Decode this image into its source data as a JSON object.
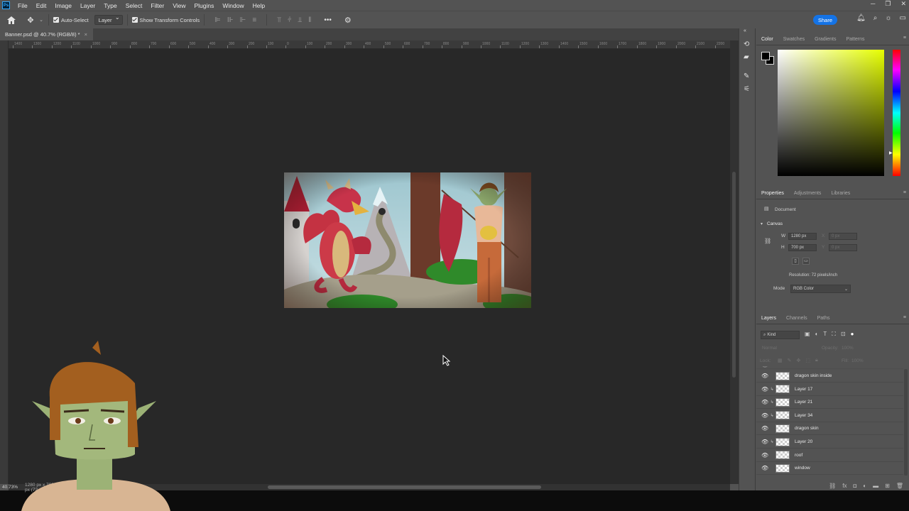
{
  "menu": [
    "File",
    "Edit",
    "Image",
    "Layer",
    "Type",
    "Select",
    "Filter",
    "View",
    "Plugins",
    "Window",
    "Help"
  ],
  "options": {
    "auto_select_label": "Auto-Select",
    "auto_select_target": "Layer",
    "transform_label": "Show Transform Controls",
    "more": "•••",
    "share": "Share"
  },
  "document": {
    "tab_title": "Banner.psd @ 40.7% (RGB/8) *",
    "close": "×"
  },
  "ruler_labels": [
    "1400",
    "1300",
    "1200",
    "1100",
    "1000",
    "900",
    "800",
    "700",
    "600",
    "500",
    "400",
    "300",
    "200",
    "100",
    "0",
    "100",
    "200",
    "300",
    "400",
    "500",
    "600",
    "700",
    "800",
    "900",
    "1000",
    "1100",
    "1200",
    "1300",
    "1400",
    "1500",
    "1600",
    "1700",
    "1800",
    "1900",
    "2000",
    "2100",
    "2200"
  ],
  "status": {
    "zoom": "40.73%",
    "size": "1280 px x 700 px (72 ppi)"
  },
  "color_panel": {
    "tabs": [
      "Color",
      "Swatches",
      "Gradients",
      "Patterns"
    ],
    "active": 0,
    "hue_color": "#e6ff00"
  },
  "properties_panel": {
    "tabs": [
      "Properties",
      "Adjustments",
      "Libraries"
    ],
    "doc_label": "Document",
    "canvas_label": "Canvas",
    "w_label": "W",
    "w_value": "1280 px",
    "h_label": "H",
    "h_value": "700 px",
    "x_label": "X",
    "x_value": "0 px",
    "y_label": "Y",
    "y_value": "0 px",
    "resolution": "Resolution: 72 pixels/inch",
    "mode_label": "Mode",
    "mode_value": "RGB Color"
  },
  "layers_panel": {
    "tabs": [
      "Layers",
      "Channels",
      "Paths"
    ],
    "kind_filter": "Kind",
    "blend_mode": "Normal",
    "opacity_label": "Opacity:",
    "opacity_value": "100%",
    "lock_label": "Lock:",
    "fill_label": "Fill:",
    "fill_value": "100%",
    "layers": [
      {
        "name": "dragon skin inside",
        "clipped": false
      },
      {
        "name": "Layer 17",
        "clipped": true
      },
      {
        "name": "Layer 21",
        "clipped": true
      },
      {
        "name": "Layer 34",
        "clipped": true
      },
      {
        "name": "dragon skin",
        "clipped": false
      },
      {
        "name": "Layer 20",
        "clipped": true
      },
      {
        "name": "roof",
        "clipped": false
      },
      {
        "name": "window",
        "clipped": false
      }
    ]
  }
}
